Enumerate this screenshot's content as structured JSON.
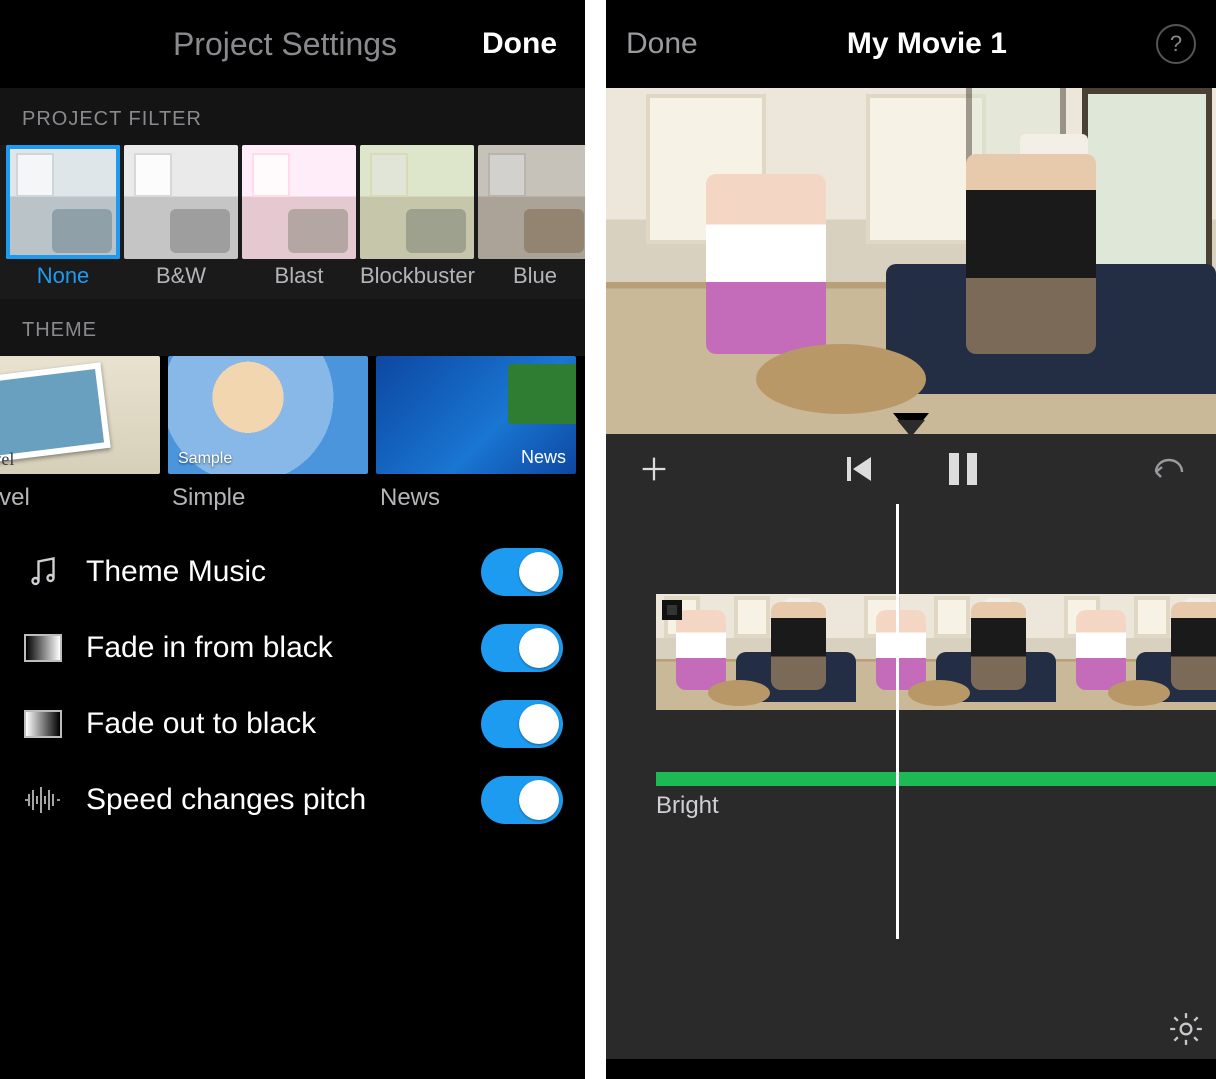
{
  "left": {
    "header": {
      "title": "Project Settings",
      "done": "Done"
    },
    "filter_section_label": "PROJECT FILTER",
    "filters": [
      {
        "label": "None",
        "selected": true
      },
      {
        "label": "B&W",
        "selected": false
      },
      {
        "label": "Blast",
        "selected": false
      },
      {
        "label": "Blockbuster",
        "selected": false
      },
      {
        "label": "Blue",
        "selected": false
      }
    ],
    "theme_section_label": "THEME",
    "themes": [
      {
        "label": "Travel",
        "caption": "Travel"
      },
      {
        "label": "Simple",
        "caption": "Sample"
      },
      {
        "label": "News",
        "caption": "News"
      }
    ],
    "toggles": {
      "theme_music": {
        "label": "Theme Music",
        "on": true
      },
      "fade_in": {
        "label": "Fade in from black",
        "on": true
      },
      "fade_out": {
        "label": "Fade out to black",
        "on": true
      },
      "speed_pitch": {
        "label": "Speed changes pitch",
        "on": true
      }
    }
  },
  "right": {
    "header": {
      "done": "Done",
      "title": "My Movie 1",
      "help": "?"
    },
    "transport": {
      "add": "add-icon",
      "prev": "skip-back-icon",
      "playpause": "pause-icon",
      "undo": "undo-icon"
    },
    "timeline": {
      "audio_track_label": "Bright"
    }
  }
}
